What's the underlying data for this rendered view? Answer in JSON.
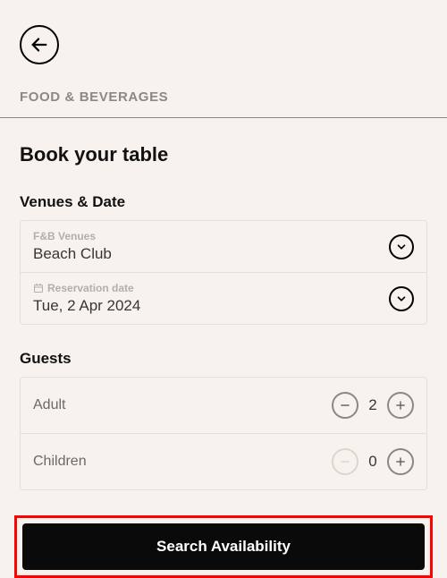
{
  "header": {
    "section_label": "FOOD & BEVERAGES"
  },
  "page": {
    "title": "Book your table"
  },
  "venues_date": {
    "group_label": "Venues & Date",
    "venue_label": "F&B Venues",
    "venue_value": "Beach Club",
    "date_label": "Reservation date",
    "date_value": "Tue, 2 Apr 2024"
  },
  "guests": {
    "group_label": "Guests",
    "adult_label": "Adult",
    "adult_count": "2",
    "children_label": "Children",
    "children_count": "0"
  },
  "actions": {
    "search_label": "Search Availability"
  }
}
